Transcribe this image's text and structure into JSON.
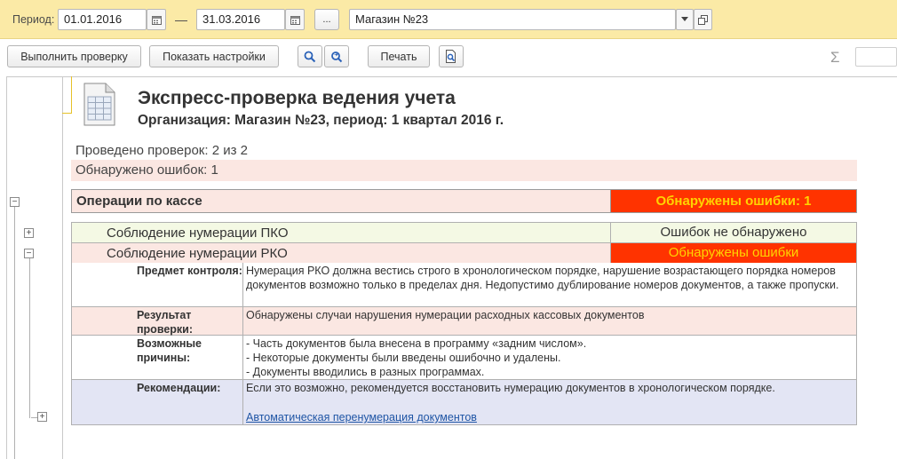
{
  "filter": {
    "period_label": "Период:",
    "date_from": "01.01.2016",
    "dash": "—",
    "date_to": "31.03.2016",
    "ellipsis": "...",
    "org": "Магазин №23"
  },
  "toolbar": {
    "run_check": "Выполнить проверку",
    "show_settings": "Показать настройки",
    "print": "Печать",
    "sum_symbol": "Σ"
  },
  "report": {
    "title": "Экспресс-проверка ведения учета",
    "subtitle": "Организация: Магазин №23, период: 1 квартал 2016 г.",
    "checks_done": "Проведено проверок: 2 из 2",
    "errors_found": "Обнаружено ошибок: 1",
    "section": {
      "name": "Операции по кассе",
      "status": "Обнаружены ошибки: 1"
    },
    "checks": [
      {
        "name": "Соблюдение нумерации ПКО",
        "status": "Ошибок не обнаружено"
      },
      {
        "name": "Соблюдение нумерации РКО",
        "status": "Обнаружены ошибки"
      }
    ],
    "details": {
      "subject_label": "Предмет контроля:",
      "subject_text": "Нумерация РКО должна вестись строго в хронологическом порядке, нарушение возрастающего порядка номеров документов возможно только в пределах дня. Недопустимо дублирование номеров документов, а также пропуски.",
      "result_label": "Результат проверки:",
      "result_text": "Обнаружены случаи нарушения нумерации расходных кассовых документов",
      "causes_label": "Возможные причины:",
      "causes": [
        "- Часть документов была внесена в программу «задним числом».",
        "- Некоторые документы были введены ошибочно и удалены.",
        "- Документы вводились в разных программах."
      ],
      "reco_label": "Рекомендации:",
      "reco_text": "Если это возможно, рекомендуется восстановить нумерацию документов в хронологическом порядке.",
      "reco_link": "Автоматическая перенумерация документов"
    }
  },
  "colors": {
    "filter_bar": "#fbeaa6",
    "error_red": "#ff3300",
    "error_yellow_text": "#ffd400",
    "ok_green_bg": "#f4f9e4",
    "pink_bg": "#fbe7e2",
    "reco_bg": "#e3e5f4",
    "link": "#1f55a5"
  }
}
